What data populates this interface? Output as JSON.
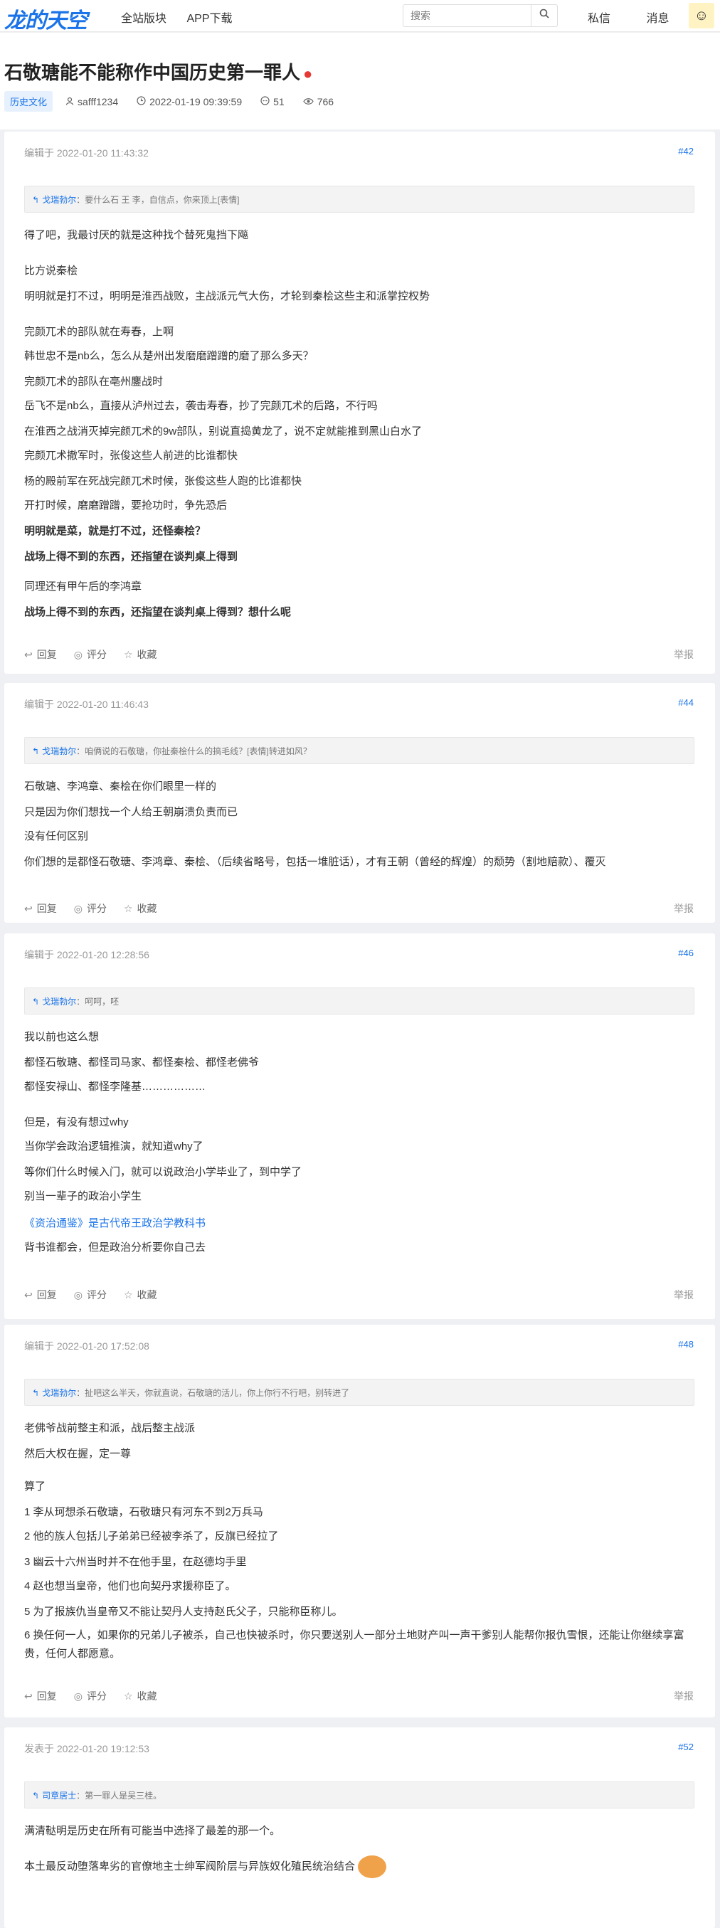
{
  "header": {
    "logo": "龙的天空",
    "nav": [
      "全站版块",
      "APP下载"
    ],
    "search_placeholder": "搜索",
    "right": [
      "私信",
      "消息"
    ]
  },
  "thread": {
    "title": "石敬瑭能不能称作中国历史第一罪人",
    "tag": "历史文化",
    "author": "safff1234",
    "datetime": "2022-01-19 09:39:59",
    "replies": "51",
    "views": "766"
  },
  "actions": {
    "reply": "回复",
    "rate": "评分",
    "fav": "收藏",
    "report": "举报"
  },
  "posts": [
    {
      "head": "编辑于 2022-01-20 11:43:32",
      "num": "#42",
      "quote_name": "戈瑞勃尔",
      "quote_text": "：要什么石 王 李，自信点，你来顶上[表情]",
      "lines": [
        {
          "t": "得了吧，我最讨厌的就是这种找个替死鬼挡下飚"
        },
        {
          "t": "比方说秦桧"
        },
        {
          "t": "明明就是打不过，明明是淮西战败，主战派元气大伤，才轮到秦桧这些主和派掌控权势"
        },
        {
          "t": "完颜兀术的部队就在寿春，上啊"
        },
        {
          "t": "韩世忠不是nb么，怎么从楚州出发磨磨蹭蹭的磨了那么多天？"
        },
        {
          "t": "完颜兀术的部队在亳州鏖战时"
        },
        {
          "t": "岳飞不是nb么，直接从泸州过去，袭击寿春，抄了完颜兀术的后路，不行吗"
        },
        {
          "t": "在淮西之战消灭掉完颜兀术的9w部队，别说直捣黄龙了，说不定就能推到黑山白水了"
        },
        {
          "t": "完颜兀术撤军时，张俊这些人前进的比谁都快"
        },
        {
          "t": "杨的殿前军在死战完颜兀术时候，张俊这些人跑的比谁都快"
        },
        {
          "t": "开打时候，磨磨蹭蹭，要抢功时，争先恐后"
        },
        {
          "t": "明明就是菜，就是打不过，还怪秦桧？"
        },
        {
          "t": "战场上得不到的东西，还指望在谈判桌上得到"
        },
        {
          "t": "同理还有甲午后的李鸿章"
        },
        {
          "t": "战场上得不到的东西，还指望在谈判桌上得到？想什么呢"
        }
      ]
    },
    {
      "head": "编辑于 2022-01-20 11:46:43",
      "num": "#44",
      "quote_name": "戈瑞勃尔",
      "quote_text": "：咱俩说的石敬瑭，你扯秦桧什么的搞毛线？[表情]转进如风？",
      "lines": [
        {
          "t": "石敬瑭、李鸿章、秦桧在你们眼里一样的"
        },
        {
          "t": "只是因为你们想找一个人给王朝崩溃负责而已"
        },
        {
          "t": "没有任何区别"
        },
        {
          "t": "你们想的是都怪石敬瑭、李鸿章、秦桧、（后续省略号，包括一堆脏话），才有王朝（曾经的辉煌）的颓势（割地赔款）、覆灭"
        }
      ]
    },
    {
      "head": "编辑于 2022-01-20 12:28:56",
      "num": "#46",
      "quote_name": "戈瑞勃尔",
      "quote_text": "：呵呵，呸",
      "lines": [
        {
          "t": "我以前也这么想"
        },
        {
          "t": "都怪石敬瑭、都怪司马家、都怪秦桧、都怪老佛爷"
        },
        {
          "t": "都怪安禄山、都怪李隆基………………"
        },
        {
          "t": "但是，有没有想过why"
        },
        {
          "t": "当你学会政治逻辑推演，就知道why了"
        },
        {
          "t": "等你们什么时候入门，就可以说政治小学毕业了，到中学了"
        },
        {
          "t": "别当一辈子的政治小学生"
        },
        {
          "t": "《资治通鉴》是古代帝王政治学教科书"
        },
        {
          "t": "背书谁都会，但是政治分析要你自己去"
        }
      ]
    },
    {
      "head": "编辑于 2022-01-20 17:52:08",
      "num": "#48",
      "quote_name": "戈瑞勃尔",
      "quote_text": "：扯吧这么半天，你就直说，石敬瑭的活儿，你上你行不行吧，别转进了",
      "lines": [
        {
          "t": "老佛爷战前整主和派，战后整主战派"
        },
        {
          "t": "然后大权在握，定一尊"
        },
        {
          "t": "算了"
        },
        {
          "t": "1 李从珂想杀石敬瑭，石敬瑭只有河东不到2万兵马"
        },
        {
          "t": "2 他的族人包括儿子弟弟已经被李杀了，反旗已经拉了"
        },
        {
          "t": "3 幽云十六州当时并不在他手里，在赵德均手里"
        },
        {
          "t": "4 赵也想当皇帝，他们也向契丹求援称臣了。"
        },
        {
          "t": "5 为了报族仇当皇帝又不能让契丹人支持赵氏父子，只能称臣称儿。"
        },
        {
          "t": "6 换任何一人，如果你的兄弟儿子被杀，自己也快被杀时，你只要送别人一部分土地财产叫一声干爹别人能帮你报仇雪恨，还能让你继续享富贵，任何人都愿意。"
        }
      ]
    },
    {
      "head": "发表于 2022-01-20 19:12:53",
      "num": "#52",
      "quote_name": "司章居士",
      "quote_text": "：第一罪人是吴三桂。",
      "lines": [
        {
          "t": "满清鞑明是历史在所有可能当中选择了最差的那一个。"
        },
        {
          "t": "本土最反动堕落卑劣的官僚地主士绅军阀阶层与异族奴化殖民统治结合"
        }
      ]
    }
  ]
}
